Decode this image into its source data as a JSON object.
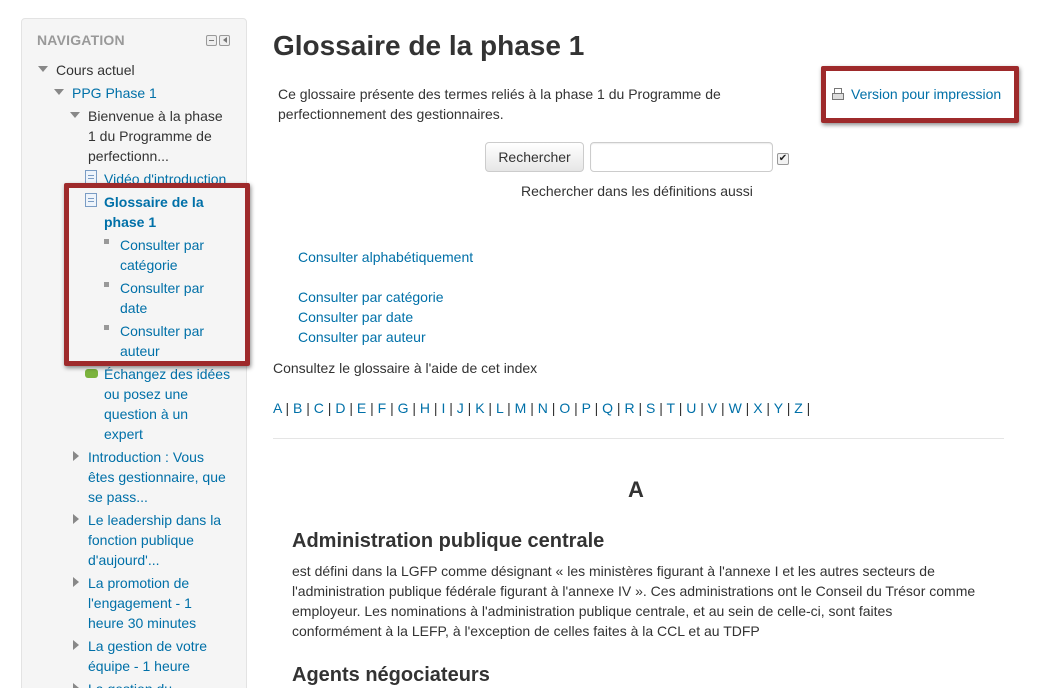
{
  "navigation": {
    "title": "NAVIGATION",
    "items": {
      "cours_actuel": "Cours actuel",
      "ppg_phase": "PPG Phase 1",
      "bienvenue": [
        "Bienvenue à la phase",
        "1 du Programme de",
        "perfectionn..."
      ],
      "video": "Vidéo d'introduction",
      "glossaire": [
        "Glossaire de la",
        "phase 1"
      ],
      "sub": [
        [
          "Consulter par",
          "catégorie"
        ],
        [
          "Consulter par",
          "date"
        ],
        [
          "Consulter par",
          "auteur"
        ]
      ],
      "echangez": [
        "Échangez des idées",
        "ou posez une",
        "question à un",
        "expert"
      ],
      "introduction": [
        "Introduction : Vous",
        "êtes gestionnaire, que",
        "se pass..."
      ],
      "leadership": [
        "Le leadership dans la",
        "fonction publique",
        "d'aujourd'..."
      ],
      "promotion": [
        "La promotion de",
        "l'engagement - 1",
        "heure 30 minutes"
      ],
      "gestion_equipe": [
        "La gestion de votre",
        "équipe - 1 heure"
      ],
      "gestion_du": "La gestion du"
    }
  },
  "main": {
    "title": "Glossaire de la phase 1",
    "intro": "Ce glossaire présente des termes reliés à la phase 1 du Programme de perfectionnement des gestionnaires.",
    "print_label": "Version pour impression",
    "search_button": "Rechercher",
    "search_value": "",
    "search_checkbox_checked": true,
    "search_note": "Rechercher dans les définitions aussi",
    "browse_alpha": "Consulter alphabétiquement",
    "browse_category": "Consulter par catégorie",
    "browse_date": "Consulter par date",
    "browse_author": "Consulter par auteur",
    "index_note": "Consultez le glossaire à l'aide de cet index",
    "letters": [
      "A",
      "B",
      "C",
      "D",
      "E",
      "F",
      "G",
      "H",
      "I",
      "J",
      "K",
      "L",
      "M",
      "N",
      "O",
      "P",
      "Q",
      "R",
      "S",
      "T",
      "U",
      "V",
      "W",
      "X",
      "Y",
      "Z"
    ],
    "current_letter": "A",
    "entries": [
      {
        "term": "Administration publique centrale",
        "definition": "est défini dans la LGFP comme désignant « les ministères figurant à l'annexe I et les autres secteurs de l'administration publique fédérale figurant à l'annexe IV ». Ces administrations ont le Conseil du Trésor comme employeur. Les nominations à l'administration publique centrale, et au sein de celle-ci, sont faites conformément à la LEFP, à l'exception de celles faites à la CCL et au TDFP"
      },
      {
        "term": "Agents négociateurs"
      }
    ]
  },
  "colors": {
    "link": "#0070a8",
    "highlight": "#9e2a2b",
    "sidebar_bg": "#f5f5f5"
  }
}
